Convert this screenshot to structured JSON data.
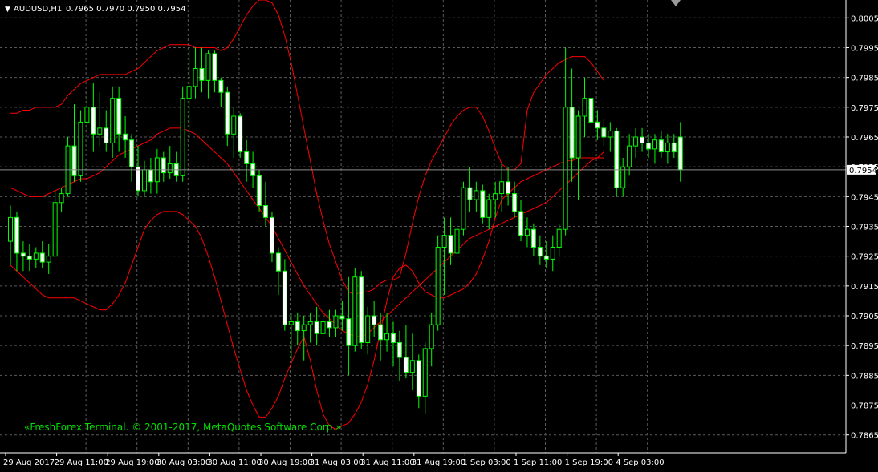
{
  "header": {
    "arrow": "▼",
    "symbol": "AUDUSD,H1",
    "ohlc": "0.7965 0.7970 0.7950 0.7954"
  },
  "watermark": "«FreshForex Terminal. © 2001-2017, MetaQuotes Software Corp.»",
  "colors": {
    "background": "#000000",
    "grid": "#5a5a5a",
    "bull_wick": "#00ff00",
    "bear_wick": "#00ff00",
    "bull_body": "#000000",
    "bear_body": "#ffffff",
    "band": "#ff0000",
    "price_line": "#8c8c8c",
    "axis_text": "#ffffff",
    "watermark": "#00e000"
  },
  "chart_data": {
    "type": "candlestick",
    "symbol": "AUDUSD",
    "timeframe": "H1",
    "current_price": 0.7954,
    "current_price_label": "0.7954",
    "ylim": [
      0.7859,
      0.8011
    ],
    "y_ticks": [
      0.7865,
      0.7875,
      0.7885,
      0.7895,
      0.7905,
      0.7915,
      0.7925,
      0.7935,
      0.7945,
      0.7955,
      0.7965,
      0.7975,
      0.7985,
      0.7995,
      0.8005
    ],
    "y_tick_labels": [
      "0.7865",
      "0.7875",
      "0.7885",
      "0.7895",
      "0.7905",
      "0.7915",
      "0.7925",
      "0.7935",
      "0.7945",
      "0.7955",
      "0.7965",
      "0.7975",
      "0.7985",
      "0.7995",
      "0.8005"
    ],
    "x_tick_labels": [
      "29 Aug 2017",
      "29 Aug 11:00",
      "29 Aug 19:00",
      "30 Aug 03:00",
      "30 Aug 11:00",
      "30 Aug 19:00",
      "31 Aug 03:00",
      "31 Aug 11:00",
      "31 Aug 19:00",
      "1 Sep 03:00",
      "1 Sep 11:00",
      "1 Sep 19:00",
      "4 Sep 03:00"
    ],
    "x_tick_bar_index": [
      0,
      8,
      16,
      24,
      32,
      40,
      48,
      56,
      64,
      72,
      80,
      88,
      96
    ],
    "candles": [
      {
        "o": 0.793,
        "h": 0.7942,
        "l": 0.7922,
        "c": 0.7938
      },
      {
        "o": 0.7938,
        "h": 0.794,
        "l": 0.792,
        "c": 0.7926
      },
      {
        "o": 0.7926,
        "h": 0.793,
        "l": 0.792,
        "c": 0.7925
      },
      {
        "o": 0.7925,
        "h": 0.7929,
        "l": 0.792,
        "c": 0.7924
      },
      {
        "o": 0.7924,
        "h": 0.7928,
        "l": 0.7921,
        "c": 0.7926
      },
      {
        "o": 0.7926,
        "h": 0.793,
        "l": 0.7921,
        "c": 0.7923
      },
      {
        "o": 0.7923,
        "h": 0.7929,
        "l": 0.7919,
        "c": 0.7925
      },
      {
        "o": 0.7925,
        "h": 0.7947,
        "l": 0.7925,
        "c": 0.7943
      },
      {
        "o": 0.7943,
        "h": 0.7948,
        "l": 0.794,
        "c": 0.7946
      },
      {
        "o": 0.7946,
        "h": 0.7965,
        "l": 0.7945,
        "c": 0.7962
      },
      {
        "o": 0.7962,
        "h": 0.7976,
        "l": 0.795,
        "c": 0.7952
      },
      {
        "o": 0.7952,
        "h": 0.7974,
        "l": 0.795,
        "c": 0.797
      },
      {
        "o": 0.797,
        "h": 0.798,
        "l": 0.7966,
        "c": 0.7975
      },
      {
        "o": 0.7975,
        "h": 0.7983,
        "l": 0.796,
        "c": 0.7966
      },
      {
        "o": 0.7966,
        "h": 0.798,
        "l": 0.7962,
        "c": 0.7968
      },
      {
        "o": 0.7968,
        "h": 0.7974,
        "l": 0.796,
        "c": 0.7963
      },
      {
        "o": 0.7963,
        "h": 0.7982,
        "l": 0.7958,
        "c": 0.7978
      },
      {
        "o": 0.7978,
        "h": 0.7982,
        "l": 0.796,
        "c": 0.7966
      },
      {
        "o": 0.7966,
        "h": 0.7972,
        "l": 0.7958,
        "c": 0.7964
      },
      {
        "o": 0.7964,
        "h": 0.7966,
        "l": 0.795,
        "c": 0.7955
      },
      {
        "o": 0.7955,
        "h": 0.7962,
        "l": 0.7945,
        "c": 0.7947
      },
      {
        "o": 0.7947,
        "h": 0.7957,
        "l": 0.7945,
        "c": 0.7954
      },
      {
        "o": 0.7954,
        "h": 0.7958,
        "l": 0.7946,
        "c": 0.795
      },
      {
        "o": 0.795,
        "h": 0.7961,
        "l": 0.7946,
        "c": 0.7958
      },
      {
        "o": 0.7958,
        "h": 0.796,
        "l": 0.795,
        "c": 0.7953
      },
      {
        "o": 0.7953,
        "h": 0.7962,
        "l": 0.7951,
        "c": 0.7956
      },
      {
        "o": 0.7956,
        "h": 0.796,
        "l": 0.795,
        "c": 0.7952
      },
      {
        "o": 0.7952,
        "h": 0.7982,
        "l": 0.795,
        "c": 0.7978
      },
      {
        "o": 0.7978,
        "h": 0.7994,
        "l": 0.7965,
        "c": 0.7982
      },
      {
        "o": 0.7982,
        "h": 0.7995,
        "l": 0.7978,
        "c": 0.7988
      },
      {
        "o": 0.7988,
        "h": 0.7995,
        "l": 0.798,
        "c": 0.7984
      },
      {
        "o": 0.7984,
        "h": 0.7994,
        "l": 0.7978,
        "c": 0.7993
      },
      {
        "o": 0.7993,
        "h": 0.7994,
        "l": 0.798,
        "c": 0.7984
      },
      {
        "o": 0.7984,
        "h": 0.7985,
        "l": 0.7975,
        "c": 0.798
      },
      {
        "o": 0.798,
        "h": 0.7982,
        "l": 0.7962,
        "c": 0.7966
      },
      {
        "o": 0.7966,
        "h": 0.7975,
        "l": 0.7958,
        "c": 0.7972
      },
      {
        "o": 0.7972,
        "h": 0.7973,
        "l": 0.7958,
        "c": 0.796
      },
      {
        "o": 0.796,
        "h": 0.7964,
        "l": 0.795,
        "c": 0.7956
      },
      {
        "o": 0.7956,
        "h": 0.796,
        "l": 0.7948,
        "c": 0.7952
      },
      {
        "o": 0.7952,
        "h": 0.7954,
        "l": 0.794,
        "c": 0.7942
      },
      {
        "o": 0.7942,
        "h": 0.795,
        "l": 0.7935,
        "c": 0.7938
      },
      {
        "o": 0.7938,
        "h": 0.794,
        "l": 0.7923,
        "c": 0.7926
      },
      {
        "o": 0.7926,
        "h": 0.7928,
        "l": 0.7912,
        "c": 0.792
      },
      {
        "o": 0.792,
        "h": 0.7924,
        "l": 0.79,
        "c": 0.7902
      },
      {
        "o": 0.7902,
        "h": 0.7906,
        "l": 0.789,
        "c": 0.7903
      },
      {
        "o": 0.7903,
        "h": 0.7906,
        "l": 0.7895,
        "c": 0.79
      },
      {
        "o": 0.79,
        "h": 0.7905,
        "l": 0.789,
        "c": 0.7902
      },
      {
        "o": 0.7902,
        "h": 0.7906,
        "l": 0.7896,
        "c": 0.7903
      },
      {
        "o": 0.7903,
        "h": 0.7908,
        "l": 0.7895,
        "c": 0.7899
      },
      {
        "o": 0.7899,
        "h": 0.7906,
        "l": 0.7896,
        "c": 0.7903
      },
      {
        "o": 0.7903,
        "h": 0.7907,
        "l": 0.7898,
        "c": 0.7901
      },
      {
        "o": 0.7901,
        "h": 0.7907,
        "l": 0.7898,
        "c": 0.7905
      },
      {
        "o": 0.7905,
        "h": 0.791,
        "l": 0.79,
        "c": 0.7904
      },
      {
        "o": 0.7904,
        "h": 0.7918,
        "l": 0.7885,
        "c": 0.7895
      },
      {
        "o": 0.7895,
        "h": 0.7921,
        "l": 0.7893,
        "c": 0.7918
      },
      {
        "o": 0.7918,
        "h": 0.792,
        "l": 0.7894,
        "c": 0.7896
      },
      {
        "o": 0.7896,
        "h": 0.7908,
        "l": 0.7892,
        "c": 0.7905
      },
      {
        "o": 0.7905,
        "h": 0.791,
        "l": 0.7898,
        "c": 0.7902
      },
      {
        "o": 0.7902,
        "h": 0.7906,
        "l": 0.789,
        "c": 0.7897
      },
      {
        "o": 0.7897,
        "h": 0.7906,
        "l": 0.7893,
        "c": 0.7899
      },
      {
        "o": 0.7899,
        "h": 0.7903,
        "l": 0.7888,
        "c": 0.7896
      },
      {
        "o": 0.7896,
        "h": 0.79,
        "l": 0.7883,
        "c": 0.7891
      },
      {
        "o": 0.7891,
        "h": 0.7902,
        "l": 0.7884,
        "c": 0.7886
      },
      {
        "o": 0.7886,
        "h": 0.7899,
        "l": 0.788,
        "c": 0.789
      },
      {
        "o": 0.789,
        "h": 0.7892,
        "l": 0.7874,
        "c": 0.7878
      },
      {
        "o": 0.7878,
        "h": 0.7896,
        "l": 0.7872,
        "c": 0.7894
      },
      {
        "o": 0.7894,
        "h": 0.7906,
        "l": 0.7888,
        "c": 0.7902
      },
      {
        "o": 0.7902,
        "h": 0.7932,
        "l": 0.79,
        "c": 0.7928
      },
      {
        "o": 0.7928,
        "h": 0.7938,
        "l": 0.7912,
        "c": 0.7932
      },
      {
        "o": 0.7932,
        "h": 0.7938,
        "l": 0.7922,
        "c": 0.7926
      },
      {
        "o": 0.7926,
        "h": 0.794,
        "l": 0.792,
        "c": 0.7934
      },
      {
        "o": 0.7934,
        "h": 0.795,
        "l": 0.7932,
        "c": 0.7948
      },
      {
        "o": 0.7948,
        "h": 0.7955,
        "l": 0.794,
        "c": 0.7944
      },
      {
        "o": 0.7944,
        "h": 0.795,
        "l": 0.794,
        "c": 0.7947
      },
      {
        "o": 0.7947,
        "h": 0.7949,
        "l": 0.7936,
        "c": 0.7938
      },
      {
        "o": 0.7938,
        "h": 0.7946,
        "l": 0.7934,
        "c": 0.7944
      },
      {
        "o": 0.7944,
        "h": 0.795,
        "l": 0.7938,
        "c": 0.7946
      },
      {
        "o": 0.7946,
        "h": 0.7956,
        "l": 0.794,
        "c": 0.795
      },
      {
        "o": 0.795,
        "h": 0.7955,
        "l": 0.7942,
        "c": 0.7946
      },
      {
        "o": 0.7946,
        "h": 0.795,
        "l": 0.7938,
        "c": 0.794
      },
      {
        "o": 0.794,
        "h": 0.7944,
        "l": 0.793,
        "c": 0.7932
      },
      {
        "o": 0.7932,
        "h": 0.7938,
        "l": 0.7928,
        "c": 0.7934
      },
      {
        "o": 0.7934,
        "h": 0.7936,
        "l": 0.7925,
        "c": 0.7928
      },
      {
        "o": 0.7928,
        "h": 0.7932,
        "l": 0.7922,
        "c": 0.7925
      },
      {
        "o": 0.7925,
        "h": 0.793,
        "l": 0.7921,
        "c": 0.7924
      },
      {
        "o": 0.7924,
        "h": 0.7932,
        "l": 0.792,
        "c": 0.7928
      },
      {
        "o": 0.7928,
        "h": 0.7936,
        "l": 0.7925,
        "c": 0.7934
      },
      {
        "o": 0.7934,
        "h": 0.7995,
        "l": 0.7932,
        "c": 0.7975
      },
      {
        "o": 0.7975,
        "h": 0.7988,
        "l": 0.795,
        "c": 0.7958
      },
      {
        "o": 0.7958,
        "h": 0.7974,
        "l": 0.7944,
        "c": 0.7972
      },
      {
        "o": 0.7972,
        "h": 0.7985,
        "l": 0.7965,
        "c": 0.7978
      },
      {
        "o": 0.7978,
        "h": 0.7982,
        "l": 0.7966,
        "c": 0.797
      },
      {
        "o": 0.797,
        "h": 0.7974,
        "l": 0.7964,
        "c": 0.7968
      },
      {
        "o": 0.7968,
        "h": 0.7971,
        "l": 0.7962,
        "c": 0.7965
      },
      {
        "o": 0.7965,
        "h": 0.797,
        "l": 0.796,
        "c": 0.7967
      },
      {
        "o": 0.7967,
        "h": 0.7968,
        "l": 0.7945,
        "c": 0.7948
      },
      {
        "o": 0.7948,
        "h": 0.7958,
        "l": 0.7945,
        "c": 0.7955
      },
      {
        "o": 0.7955,
        "h": 0.7966,
        "l": 0.7952,
        "c": 0.7962
      },
      {
        "o": 0.7962,
        "h": 0.7968,
        "l": 0.7958,
        "c": 0.7965
      },
      {
        "o": 0.7965,
        "h": 0.7968,
        "l": 0.796,
        "c": 0.7963
      },
      {
        "o": 0.7963,
        "h": 0.7966,
        "l": 0.7958,
        "c": 0.7961
      },
      {
        "o": 0.7961,
        "h": 0.7966,
        "l": 0.7956,
        "c": 0.7964
      },
      {
        "o": 0.7964,
        "h": 0.7967,
        "l": 0.7958,
        "c": 0.796
      },
      {
        "o": 0.796,
        "h": 0.7966,
        "l": 0.7956,
        "c": 0.7963
      },
      {
        "o": 0.7963,
        "h": 0.7966,
        "l": 0.7958,
        "c": 0.796
      },
      {
        "o": 0.7965,
        "h": 0.797,
        "l": 0.795,
        "c": 0.7954
      }
    ],
    "bollinger": {
      "upper": [
        0.7973,
        0.7973,
        0.7974,
        0.7974,
        0.7975,
        0.7975,
        0.7975,
        0.7975,
        0.7976,
        0.7979,
        0.7981,
        0.7983,
        0.7984,
        0.7985,
        0.7986,
        0.7986,
        0.7986,
        0.7986,
        0.7986,
        0.7987,
        0.7988,
        0.799,
        0.7992,
        0.7994,
        0.7995,
        0.7996,
        0.7996,
        0.7996,
        0.7996,
        0.7995,
        0.7995,
        0.7995,
        0.7995,
        0.7994,
        0.7995,
        0.7998,
        0.8002,
        0.8006,
        0.8009,
        0.8011,
        0.8011,
        0.801,
        0.8006,
        0.7999,
        0.799,
        0.7979,
        0.7968,
        0.7957,
        0.7946,
        0.7937,
        0.7929,
        0.7923,
        0.7917,
        0.7913,
        0.7912,
        0.7913,
        0.7913,
        0.7914,
        0.7916,
        0.7917,
        0.7917,
        0.7918,
        0.7926,
        0.7936,
        0.7945,
        0.7952,
        0.7957,
        0.7961,
        0.7965,
        0.7969,
        0.7972,
        0.7974,
        0.7975,
        0.7975,
        0.7972,
        0.7967,
        0.7961,
        0.7956,
        0.7954,
        0.7954,
        0.7956,
        0.7974,
        0.798,
        0.7983,
        0.7986,
        0.7988,
        0.799,
        0.7991,
        0.7992,
        0.7992,
        0.7992,
        0.799,
        0.7987,
        0.7984
      ],
      "middle": [
        0.7948,
        0.7947,
        0.7946,
        0.7945,
        0.7945,
        0.7945,
        0.7946,
        0.7947,
        0.7948,
        0.7949,
        0.795,
        0.7951,
        0.7951,
        0.7952,
        0.7953,
        0.7955,
        0.7957,
        0.7959,
        0.796,
        0.7961,
        0.7962,
        0.7963,
        0.7964,
        0.7966,
        0.7967,
        0.7968,
        0.7968,
        0.7968,
        0.7967,
        0.7966,
        0.7964,
        0.7962,
        0.796,
        0.7958,
        0.7956,
        0.7953,
        0.795,
        0.7947,
        0.7944,
        0.7941,
        0.7938,
        0.7935,
        0.7931,
        0.7927,
        0.7923,
        0.7919,
        0.7915,
        0.7912,
        0.7909,
        0.7906,
        0.7904,
        0.7902,
        0.79,
        0.7899,
        0.7898,
        0.7898,
        0.7899,
        0.7901,
        0.7903,
        0.7905,
        0.7907,
        0.7909,
        0.7911,
        0.7913,
        0.7915,
        0.7917,
        0.7919,
        0.7921,
        0.7923,
        0.7925,
        0.7927,
        0.7929,
        0.7931,
        0.7932,
        0.7933,
        0.7934,
        0.7935,
        0.7936,
        0.7937,
        0.7938,
        0.7939,
        0.794,
        0.7941,
        0.7942,
        0.7943,
        0.7945,
        0.7947,
        0.7949,
        0.7951,
        0.7953,
        0.7955,
        0.7957,
        0.7958,
        0.796
      ],
      "lower": [
        0.7922,
        0.792,
        0.7918,
        0.7916,
        0.7914,
        0.7912,
        0.7911,
        0.7911,
        0.7911,
        0.7911,
        0.7911,
        0.791,
        0.7909,
        0.7908,
        0.7907,
        0.7907,
        0.7909,
        0.7912,
        0.7916,
        0.7922,
        0.7928,
        0.7934,
        0.7937,
        0.7939,
        0.794,
        0.794,
        0.794,
        0.7939,
        0.7937,
        0.7935,
        0.7931,
        0.7925,
        0.7918,
        0.791,
        0.7902,
        0.7894,
        0.7887,
        0.788,
        0.7875,
        0.7871,
        0.7871,
        0.7874,
        0.7878,
        0.7884,
        0.7889,
        0.7894,
        0.7898,
        0.789,
        0.788,
        0.7872,
        0.7868,
        0.7867,
        0.7868,
        0.7869,
        0.7872,
        0.7876,
        0.7882,
        0.789,
        0.79,
        0.791,
        0.7918,
        0.7921,
        0.7922,
        0.792,
        0.7916,
        0.7913,
        0.7912,
        0.7911,
        0.7911,
        0.7912,
        0.7913,
        0.7914,
        0.7916,
        0.7919,
        0.7924,
        0.793,
        0.7938,
        0.7944,
        0.7946,
        0.7948,
        0.795,
        0.7951,
        0.7952,
        0.7953,
        0.7954,
        0.7955,
        0.7956,
        0.7957,
        0.7957,
        0.7958,
        0.7958,
        0.7958,
        0.7958,
        0.7958
      ]
    }
  }
}
